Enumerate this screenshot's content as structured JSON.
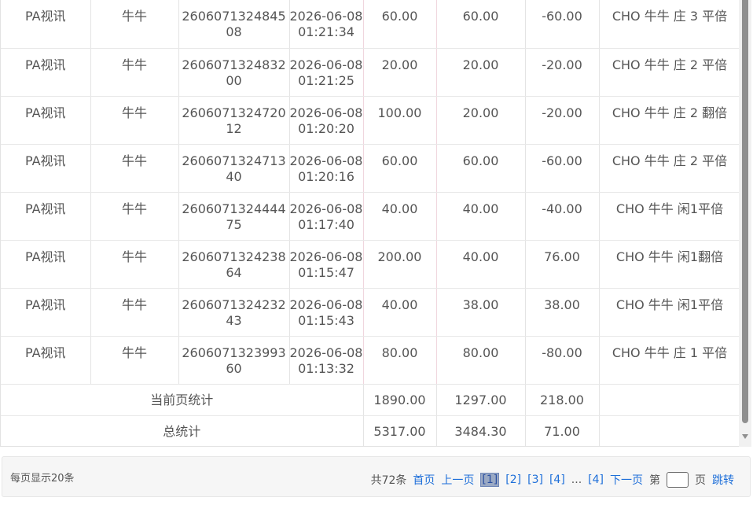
{
  "rows": [
    {
      "platform": "PA视讯",
      "game": "牛牛",
      "order_id": "260607132484508",
      "time": [
        "2026-06-08",
        "01:21:34"
      ],
      "bet": "60.00",
      "valid_bet": "60.00",
      "win_loss": "-60.00",
      "detail": "CHO 牛牛 庄 3 平倍"
    },
    {
      "platform": "PA视讯",
      "game": "牛牛",
      "order_id": "260607132483200",
      "time": [
        "2026-06-08",
        "01:21:25"
      ],
      "bet": "20.00",
      "valid_bet": "20.00",
      "win_loss": "-20.00",
      "detail": "CHO 牛牛 庄 2 平倍"
    },
    {
      "platform": "PA视讯",
      "game": "牛牛",
      "order_id": "260607132472012",
      "time": [
        "2026-06-08",
        "01:20:20"
      ],
      "bet": "100.00",
      "valid_bet": "20.00",
      "win_loss": "-20.00",
      "detail": "CHO 牛牛 庄 2 翻倍"
    },
    {
      "platform": "PA视讯",
      "game": "牛牛",
      "order_id": "260607132471340",
      "time": [
        "2026-06-08",
        "01:20:16"
      ],
      "bet": "60.00",
      "valid_bet": "60.00",
      "win_loss": "-60.00",
      "detail": "CHO 牛牛 庄 2 平倍"
    },
    {
      "platform": "PA视讯",
      "game": "牛牛",
      "order_id": "260607132444475",
      "time": [
        "2026-06-08",
        "01:17:40"
      ],
      "bet": "40.00",
      "valid_bet": "40.00",
      "win_loss": "-40.00",
      "detail": "CHO 牛牛 闲1平倍"
    },
    {
      "platform": "PA视讯",
      "game": "牛牛",
      "order_id": "260607132423864",
      "time": [
        "2026-06-08",
        "01:15:47"
      ],
      "bet": "200.00",
      "valid_bet": "40.00",
      "win_loss": "76.00",
      "detail": "CHO 牛牛 闲1翻倍"
    },
    {
      "platform": "PA视讯",
      "game": "牛牛",
      "order_id": "260607132423243",
      "time": [
        "2026-06-08",
        "01:15:43"
      ],
      "bet": "40.00",
      "valid_bet": "38.00",
      "win_loss": "38.00",
      "detail": "CHO 牛牛 闲1平倍"
    },
    {
      "platform": "PA视讯",
      "game": "牛牛",
      "order_id": "260607132399360",
      "time": [
        "2026-06-08",
        "01:13:32"
      ],
      "bet": "80.00",
      "valid_bet": "80.00",
      "win_loss": "-80.00",
      "detail": "CHO 牛牛 庄 1 平倍"
    }
  ],
  "page_summary": {
    "label": "当前页统计",
    "bet": "1890.00",
    "valid_bet": "1297.00",
    "win_loss": "218.00"
  },
  "total_summary": {
    "label": "总统计",
    "bet": "5317.00",
    "valid_bet": "3484.30",
    "win_loss": "71.00"
  },
  "pager": {
    "per_page": "每页显示20条",
    "total": "共72条",
    "first": "首页",
    "prev": "上一页",
    "pages": [
      "[1]",
      "[2]",
      "[3]",
      "[4]"
    ],
    "current_page": "[1]",
    "ellipsis": "...",
    "last_page": "[4]",
    "next": "下一页",
    "goto_prefix": "第",
    "goto_suffix": "页",
    "goto_input": "",
    "jump": "跳转"
  }
}
